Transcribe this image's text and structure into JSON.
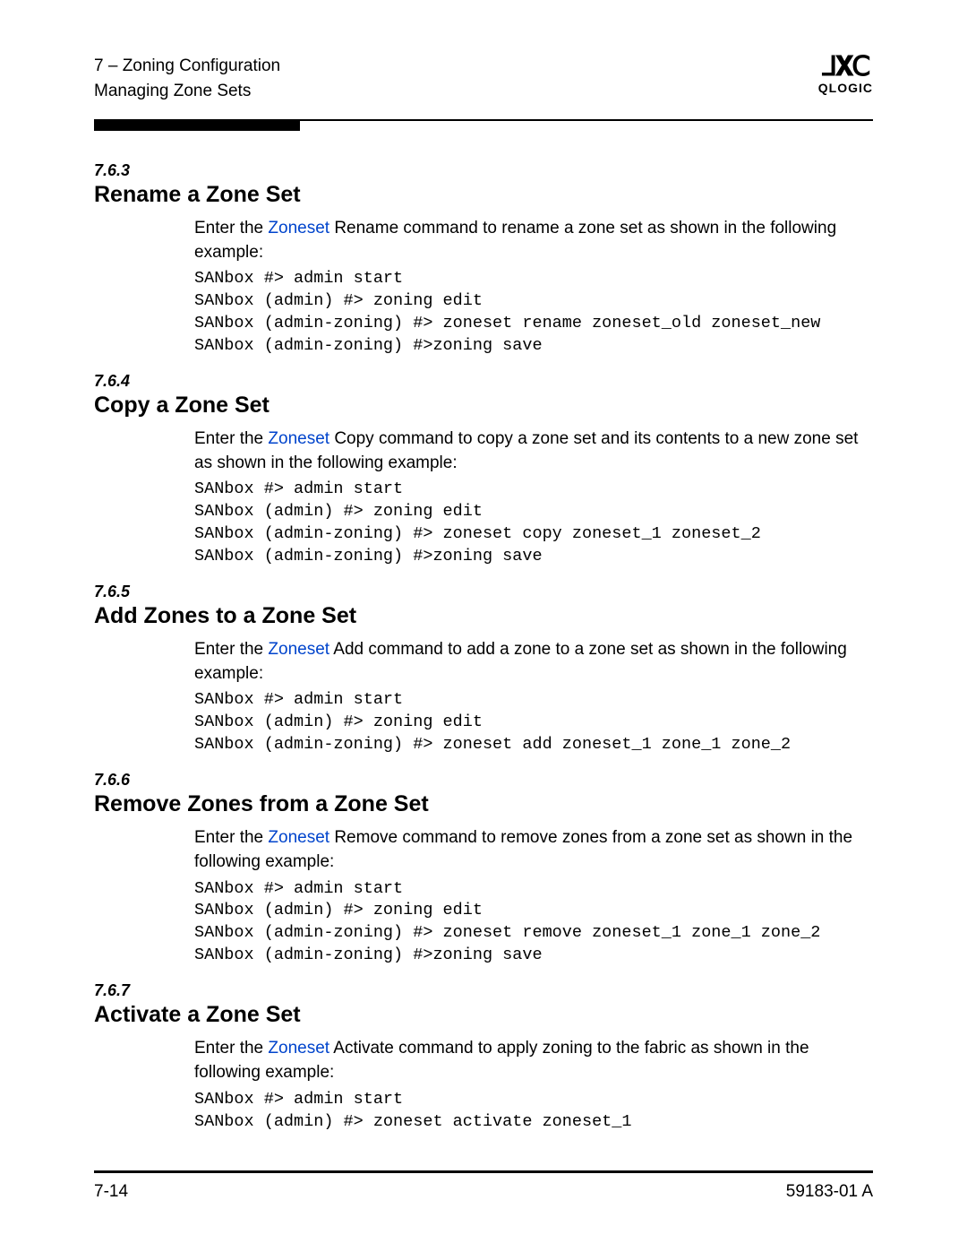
{
  "header": {
    "chapter_line": "7 – Zoning Configuration",
    "section_line": "Managing Zone Sets",
    "brand_mark": "⅃𝐗Ⅽ",
    "brand_text": "QLOGIC"
  },
  "sections": [
    {
      "num": "7.6.3",
      "title": "Rename a Zone Set",
      "intro_pre": "Enter the ",
      "intro_link": "Zoneset",
      "intro_post": " Rename command to rename a zone set as shown in the following example:",
      "code": "SANbox #> admin start\nSANbox (admin) #> zoning edit\nSANbox (admin-zoning) #> zoneset rename zoneset_old zoneset_new\nSANbox (admin-zoning) #>zoning save"
    },
    {
      "num": "7.6.4",
      "title": "Copy a Zone Set",
      "intro_pre": "Enter the ",
      "intro_link": "Zoneset",
      "intro_post": " Copy command to copy a zone set and its contents to a new zone set as shown in the following example:",
      "code": "SANbox #> admin start\nSANbox (admin) #> zoning edit\nSANbox (admin-zoning) #> zoneset copy zoneset_1 zoneset_2\nSANbox (admin-zoning) #>zoning save"
    },
    {
      "num": "7.6.5",
      "title": "Add Zones to a Zone Set",
      "intro_pre": "Enter the ",
      "intro_link": "Zoneset",
      "intro_post": " Add command to add a zone to a zone set as shown in the following example:",
      "code": "SANbox #> admin start\nSANbox (admin) #> zoning edit\nSANbox (admin-zoning) #> zoneset add zoneset_1 zone_1 zone_2"
    },
    {
      "num": "7.6.6",
      "title": "Remove Zones from a Zone Set",
      "intro_pre": "Enter the ",
      "intro_link": "Zoneset",
      "intro_post": " Remove command to remove zones from a zone set as shown in the following example:",
      "code": "SANbox #> admin start\nSANbox (admin) #> zoning edit\nSANbox (admin-zoning) #> zoneset remove zoneset_1 zone_1 zone_2\nSANbox (admin-zoning) #>zoning save"
    },
    {
      "num": "7.6.7",
      "title": "Activate a Zone Set",
      "intro_pre": "Enter the ",
      "intro_link": "Zoneset",
      "intro_post": " Activate command to apply zoning to the fabric as shown in the following example:",
      "code": "SANbox #> admin start\nSANbox (admin) #> zoneset activate zoneset_1"
    }
  ],
  "footer": {
    "page": "7-14",
    "doc_id": "59183-01 A"
  }
}
